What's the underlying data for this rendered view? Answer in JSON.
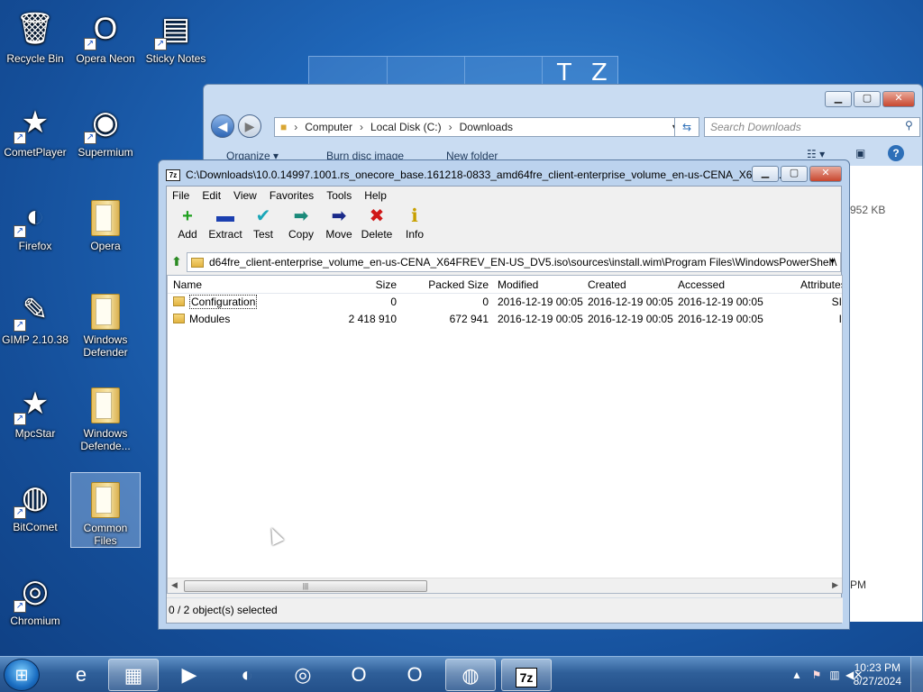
{
  "wallpaper": {
    "letters": [
      "T",
      "Z"
    ]
  },
  "desktop": [
    {
      "label": "Recycle Bin",
      "glyph": "🗑",
      "shortcut": false
    },
    {
      "label": "Opera Neon",
      "glyph": "O",
      "shortcut": true
    },
    {
      "label": "Sticky Notes",
      "glyph": "▤",
      "shortcut": true
    },
    {
      "label": "CometPlayer",
      "glyph": "★",
      "shortcut": true
    },
    {
      "label": "Supermium",
      "glyph": "◉",
      "shortcut": true
    },
    {
      "label": "Firefox",
      "glyph": "◐",
      "shortcut": true
    },
    {
      "label": "Opera",
      "glyph": "",
      "shortcut": false
    },
    {
      "label": "GIMP 2.10.38",
      "glyph": "✎",
      "shortcut": true
    },
    {
      "label": "Windows Defender",
      "glyph": "",
      "shortcut": false
    },
    {
      "label": "MpcStar",
      "glyph": "★",
      "shortcut": true
    },
    {
      "label": "Windows Defende...",
      "glyph": "",
      "shortcut": false
    },
    {
      "label": "BitComet",
      "glyph": "◍",
      "shortcut": true
    },
    {
      "label": "Common Files",
      "glyph": "",
      "shortcut": false
    },
    {
      "label": "Chromium",
      "glyph": "◎",
      "shortcut": true
    }
  ],
  "explorer": {
    "address": [
      "Computer",
      "Local Disk (C:)",
      "Downloads"
    ],
    "search_placeholder": "Search Downloads",
    "toolbar": [
      "Organize ▾",
      "Burn disc image",
      "New folder"
    ],
    "peek_size": "952 KB",
    "peek_time": "PM"
  },
  "zip": {
    "title": "C:\\Downloads\\10.0.14997.1001.rs_onecore_base.161218-0833_amd64fre_client-enterprise_volume_en-us-CENA_X64FR...",
    "logo": "7z",
    "menu": [
      "File",
      "Edit",
      "View",
      "Favorites",
      "Tools",
      "Help"
    ],
    "tools": [
      {
        "label": "Add",
        "glyph": "+",
        "color": "#1fa01f"
      },
      {
        "label": "Extract",
        "glyph": "▬",
        "color": "#1b3fb0"
      },
      {
        "label": "Test",
        "glyph": "✔",
        "color": "#1aa6b8"
      },
      {
        "label": "Copy",
        "glyph": "➡",
        "color": "#1a8a7a"
      },
      {
        "label": "Move",
        "glyph": "➡",
        "color": "#1a2a8a"
      },
      {
        "label": "Delete",
        "glyph": "✖",
        "color": "#d01818"
      },
      {
        "label": "Info",
        "glyph": "ℹ",
        "color": "#c8a000"
      }
    ],
    "path": "d64fre_client-enterprise_volume_en-us-CENA_X64FREV_EN-US_DV5.iso\\sources\\install.wim\\Program Files\\WindowsPowerShell\\",
    "columns": [
      "Name",
      "Size",
      "Packed Size",
      "Modified",
      "Created",
      "Accessed",
      "Attributes"
    ],
    "rows": [
      {
        "name": "Configuration",
        "size": "0",
        "packed": "0",
        "modified": "2016-12-19 00:05",
        "created": "2016-12-19 00:05",
        "accessed": "2016-12-19 00:05",
        "attr": "SI"
      },
      {
        "name": "Modules",
        "size": "2 418 910",
        "packed": "672 941",
        "modified": "2016-12-19 00:05",
        "created": "2016-12-19 00:05",
        "accessed": "2016-12-19 00:05",
        "attr": "I"
      }
    ],
    "status": "0 / 2 object(s) selected"
  },
  "taskbar": {
    "buttons": [
      {
        "name": "internet-explorer",
        "glyph": "e",
        "active": false
      },
      {
        "name": "explorer",
        "glyph": "▦",
        "active": true
      },
      {
        "name": "media-player",
        "glyph": "▶",
        "active": false
      },
      {
        "name": "firefox",
        "glyph": "◐",
        "active": false
      },
      {
        "name": "chromium",
        "glyph": "◎",
        "active": false
      },
      {
        "name": "opera-neon",
        "glyph": "O",
        "active": false
      },
      {
        "name": "opera",
        "glyph": "O",
        "active": false
      },
      {
        "name": "bitcomet",
        "glyph": "◍",
        "active": true
      },
      {
        "name": "7zip",
        "glyph": "7z",
        "active": true
      }
    ],
    "time": "10:23 PM",
    "date": "8/27/2024"
  }
}
